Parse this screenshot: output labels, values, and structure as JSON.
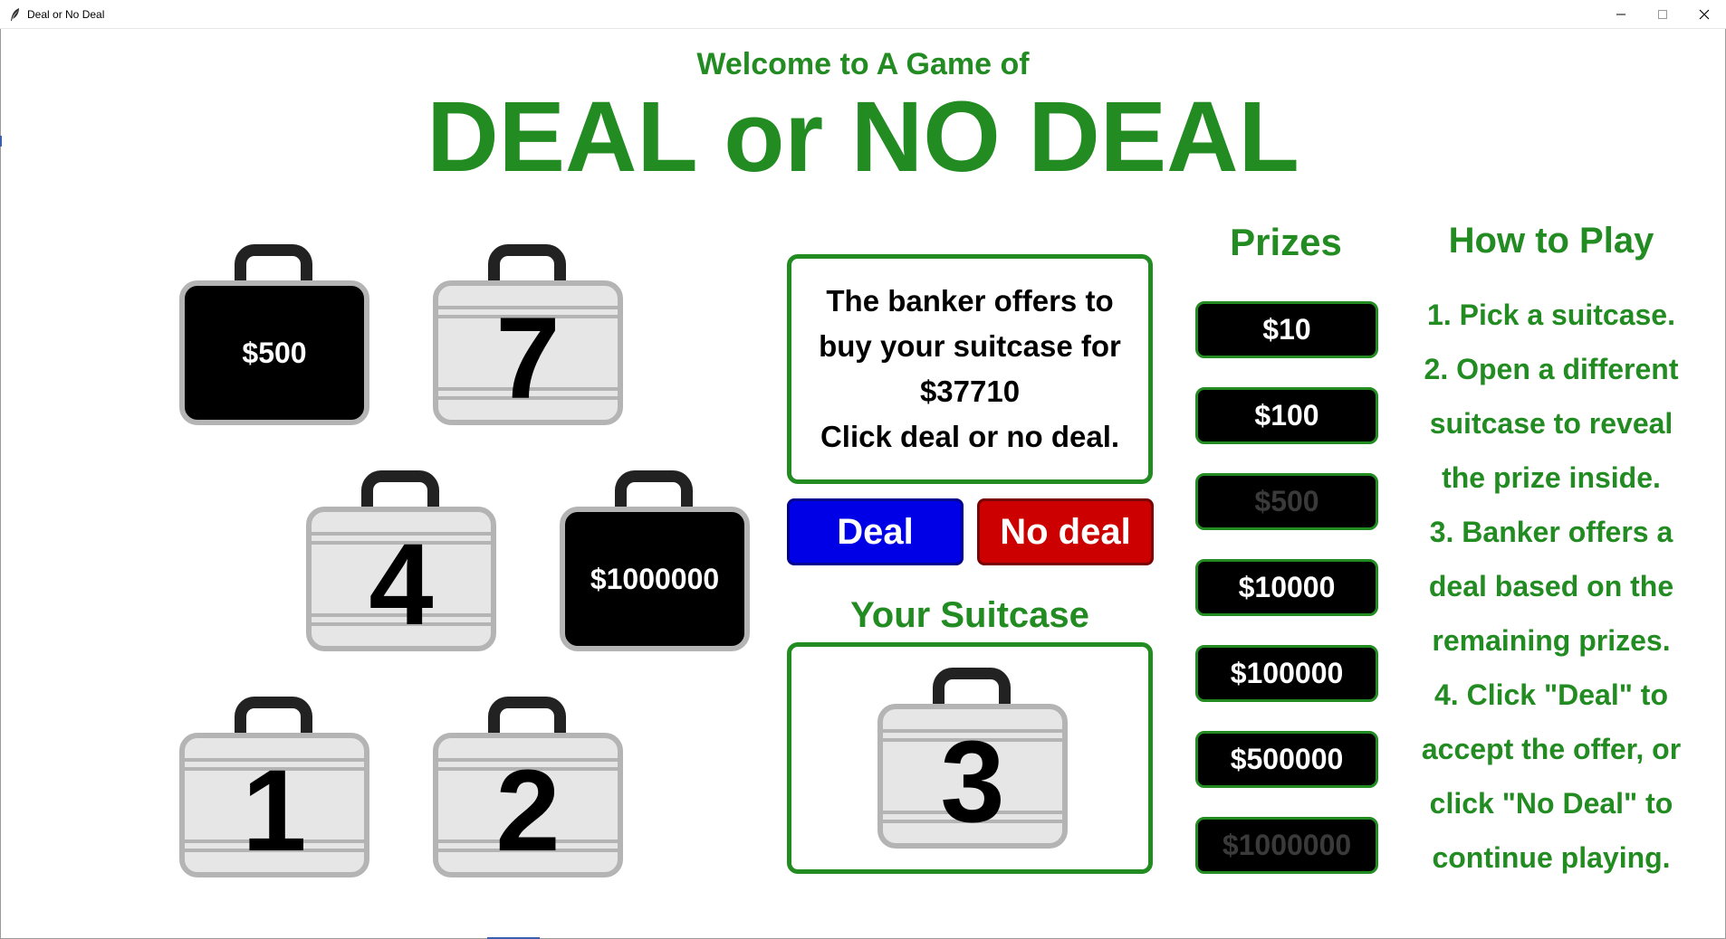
{
  "window": {
    "title": "Deal or No Deal"
  },
  "header": {
    "welcome": "Welcome to A Game of",
    "title": "DEAL or NO DEAL"
  },
  "board": {
    "suitcases": [
      {
        "label": "$500",
        "opened": true
      },
      {
        "label": "7",
        "opened": false
      },
      {
        "label": "4",
        "opened": false
      },
      {
        "label": "$1000000",
        "opened": true
      },
      {
        "label": "1",
        "opened": false
      },
      {
        "label": "2",
        "opened": false
      }
    ]
  },
  "banker": {
    "lines": [
      "The banker offers to",
      "buy your suitcase for",
      "$37710",
      "Click deal or no deal."
    ],
    "deal_label": "Deal",
    "nodeal_label": "No deal"
  },
  "your_suitcase": {
    "heading": "Your Suitcase",
    "number": "3"
  },
  "prizes": {
    "heading": "Prizes",
    "items": [
      {
        "label": "$10",
        "eliminated": false
      },
      {
        "label": "$100",
        "eliminated": false
      },
      {
        "label": "$500",
        "eliminated": true
      },
      {
        "label": "$10000",
        "eliminated": false
      },
      {
        "label": "$100000",
        "eliminated": false
      },
      {
        "label": "$500000",
        "eliminated": false
      },
      {
        "label": "$1000000",
        "eliminated": true
      }
    ]
  },
  "howto": {
    "heading": "How to Play",
    "lines": [
      "1. Pick a suitcase.",
      "2. Open a different",
      "suitcase to reveal",
      "the prize inside.",
      "3. Banker offers a",
      "deal based on the",
      "remaining prizes.",
      "4. Click \"Deal\" to",
      "accept the offer, or",
      "click \"No Deal\" to",
      "continue playing."
    ]
  },
  "colors": {
    "accent_green": "#228b22",
    "deal_blue": "#0000e6",
    "nodeal_red": "#cc0000",
    "case_silver": "#e6e6e6",
    "opened_case": "#000000"
  }
}
